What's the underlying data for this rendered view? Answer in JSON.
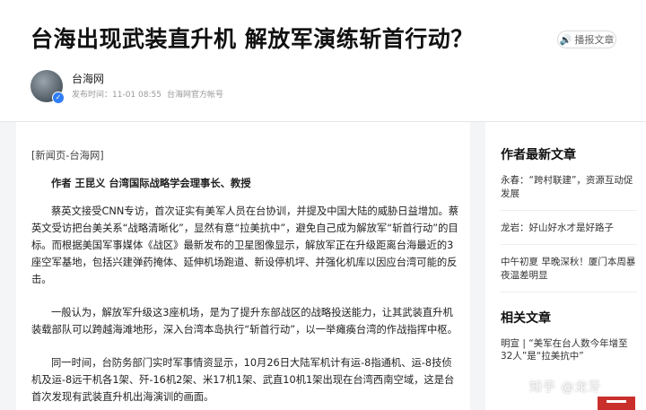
{
  "header": {
    "title": "台海出现武装直升机 解放军演练斩首行动？",
    "listen_label": "播报文章",
    "author": {
      "name": "台海网",
      "published": "发布时间：11-01 08:55",
      "account": "台海网官方帐号"
    }
  },
  "article": {
    "source": "[新闻页-台海网]",
    "byline": "作者 王昆义 台湾国际战略学会理事长、教授",
    "paragraphs": [
      "蔡英文接受CNN专访，首次证实有美军人员在台协训，并提及中国大陆的威胁日益增加。蔡英文受访把台美关系“战略清晰化”，显然有意“拉美抗中”，避免自己成为解放军“斩首行动”的目标。而根据美国军事媒体《战区》最新发布的卫星图像显示，解放军正在升级距离台海最近的3座空军基地，包括兴建弹药掩体、延伸机场跑道、新设停机坪、并强化机库以因应台湾可能的反击。",
      "一般认为，解放军升级这3座机场，是为了提升东部战区的战略投送能力，让其武装直升机装载部队可以跨越海滩地形，深入台湾本岛执行“斩首行动”，以一举瘫痪台湾的作战指挥中枢。",
      "同一时间，台防务部门实时军事情资显示，10月26日大陆军机计有运-8指通机、运-8技侦机及运-8远干机各1架、歼-16机2架、米17机1架、武直10机1架出现在台湾西南空域，这是台首次发现有武装直升机出海演训的画面。"
    ]
  },
  "sidebar": {
    "latest_heading": "作者最新文章",
    "latest_items": [
      "永春：“跨村联建”，资源互动促发展",
      "龙岩：好山好水才是好路子",
      "中午初夏 早晚深秋！厦门本周暴夜温差明显"
    ],
    "related_heading": "相关文章",
    "related_items": [
      "明宣 | “美军在台人数今年增至32人”是“拉美抗中”"
    ]
  },
  "watermark": "知乎 @龙牙",
  "colors": {
    "verified_badge": "#2f7df6",
    "page_background": "#f4f5f6"
  }
}
